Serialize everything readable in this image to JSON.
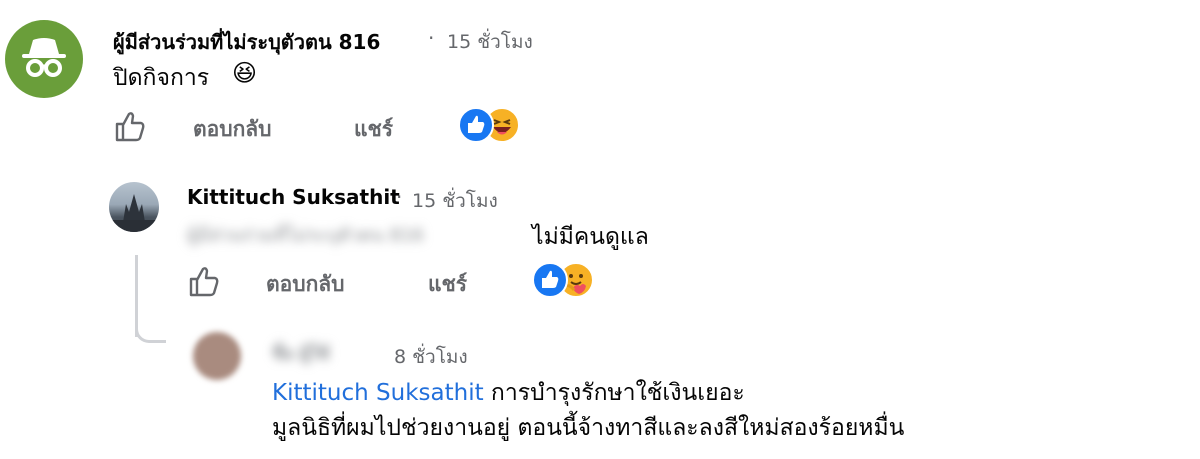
{
  "comments": [
    {
      "author": "ผู้มีส่วนร่วมที่ไม่ระบุตัวตน 816",
      "separator": "·",
      "time": "15 ชั่วโมง",
      "text": "ปิดกิจการ",
      "emoji": "😆",
      "actions": {
        "reply": "ตอบกลับ",
        "share": "แชร์"
      },
      "avatar_color": "#6a9e3a"
    },
    {
      "author": "Kittituch Suksathit",
      "separator": "·",
      "time": "15 ชั่วโมง",
      "blurred_mention": "ผู้มีส่วนร่วมที่ไม่ระบุตัวตน 816",
      "text": "ไม่มีคนดูแล",
      "actions": {
        "reply": "ตอบกลับ",
        "share": "แชร์"
      }
    },
    {
      "author_blurred": "ชื่อ ผู้ใช้",
      "time": "8 ชั่วโมง",
      "mention": "Kittituch Suksathit",
      "line1": "การบำรุงรักษาใช้เงินเยอะ",
      "line2": "มูลนิธิที่ผมไปช่วยงานอยู่ ตอนนี้จ้างทาสีและลงสีใหม่สองร้อยหมื่น"
    }
  ],
  "colors": {
    "like_blue": "#1877f2",
    "haha_yellow": "#f7b125",
    "link_blue": "#216fdb"
  },
  "icons": [
    "incognito-icon",
    "like-icon",
    "like-reaction-icon",
    "haha-reaction-icon",
    "care-reaction-icon"
  ]
}
